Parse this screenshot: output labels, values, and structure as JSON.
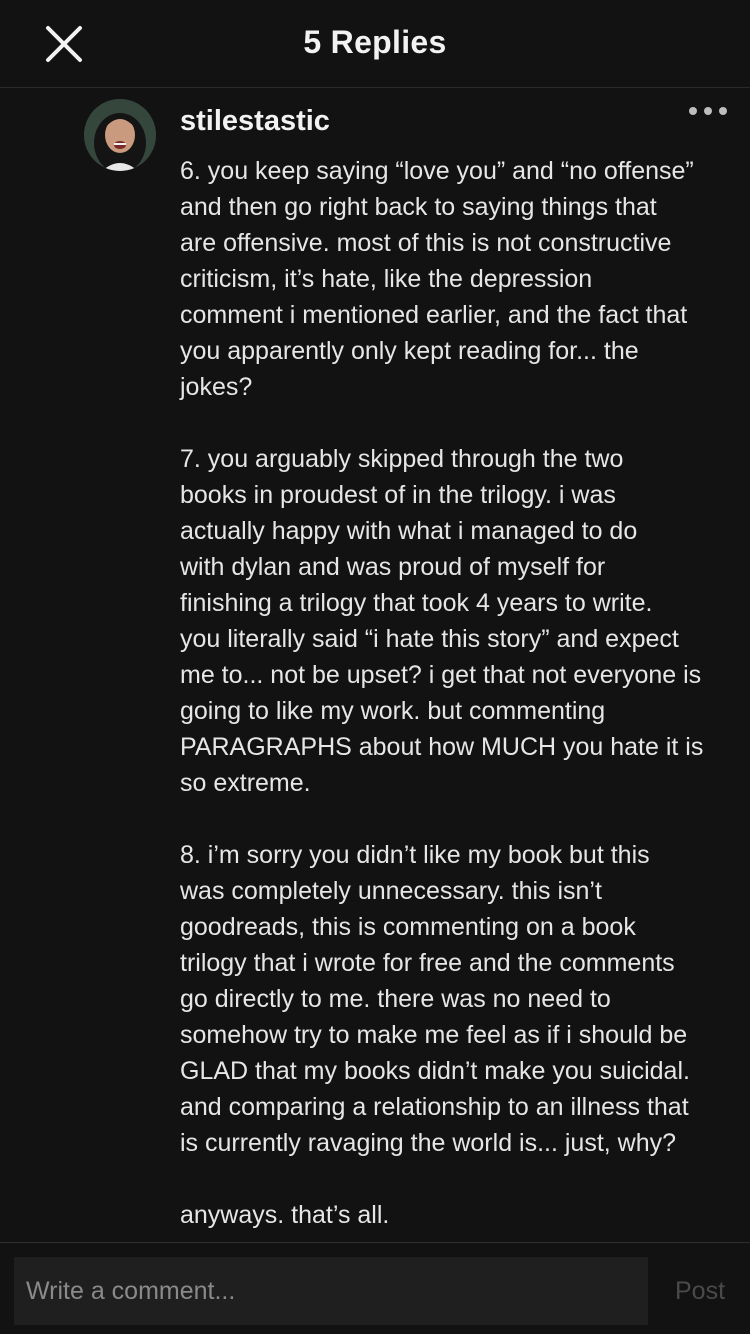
{
  "header": {
    "title": "5 Replies",
    "close_icon": "close-icon"
  },
  "comment": {
    "username": "stilestastic",
    "more_icon": "more-horizontal-icon",
    "paragraphs": [
      [
        "6. you keep saying “love you” and “no offense”",
        "and then go right back to saying things that",
        "are offensive. most of this is not constructive",
        "criticism, it’s hate, like the depression",
        "comment i mentioned earlier, and the fact that",
        "you apparently only kept reading for... the",
        "jokes?"
      ],
      [
        "7. you arguably skipped through the two",
        "books in proudest of in the trilogy. i was",
        "actually happy with what i managed to do",
        "with dylan and was proud of myself for",
        "finishing a trilogy that took 4 years to write.",
        "you literally said “i hate this story” and expect",
        "me to... not be upset? i get that not everyone is",
        "going to like my work. but commenting",
        "PARAGRAPHS about how MUCH you hate it is",
        "so extreme."
      ],
      [
        "8. i’m sorry you didn’t like my book but this",
        "was completely unnecessary. this isn’t",
        "goodreads, this is commenting on a book",
        "trilogy that i wrote for free and the comments",
        "go directly to me. there was no need to",
        "somehow try to make me feel as if i should be",
        "GLAD that my books didn’t make you suicidal.",
        "and comparing a relationship to an illness that",
        "is currently ravaging the world is... just, why?"
      ],
      [
        "anyways. that’s all."
      ]
    ]
  },
  "footer": {
    "placeholder": "Write a comment...",
    "post_label": "Post"
  },
  "colors": {
    "background": "#121212",
    "text": "#e6e6e6",
    "input_bg": "#1f1f1f",
    "post_disabled": "#4a4a4a"
  }
}
